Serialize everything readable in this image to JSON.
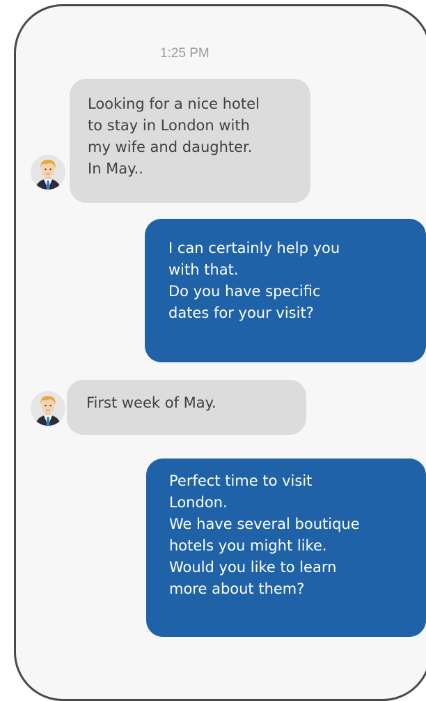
{
  "chat": {
    "timestamp": "1:25 PM",
    "messages": [
      {
        "sender": "user",
        "text": "Looking for a nice hotel\nto stay in London with\nmy wife and daughter.\nIn May.."
      },
      {
        "sender": "agent",
        "text": "I can certainly help you\nwith that.\nDo you have specific\ndates for your visit?"
      },
      {
        "sender": "user",
        "text": "First week of May."
      },
      {
        "sender": "agent",
        "text": "Perfect time to visit\nLondon.\nWe have several boutique\nhotels you might like.\nWould you like to learn\nmore about them?"
      }
    ],
    "avatar_icon": "businessman-avatar-icon",
    "colors": {
      "incoming_bubble": "#dcdcdc",
      "outgoing_bubble": "#1f62a8",
      "background": "#f7f7f7"
    }
  }
}
